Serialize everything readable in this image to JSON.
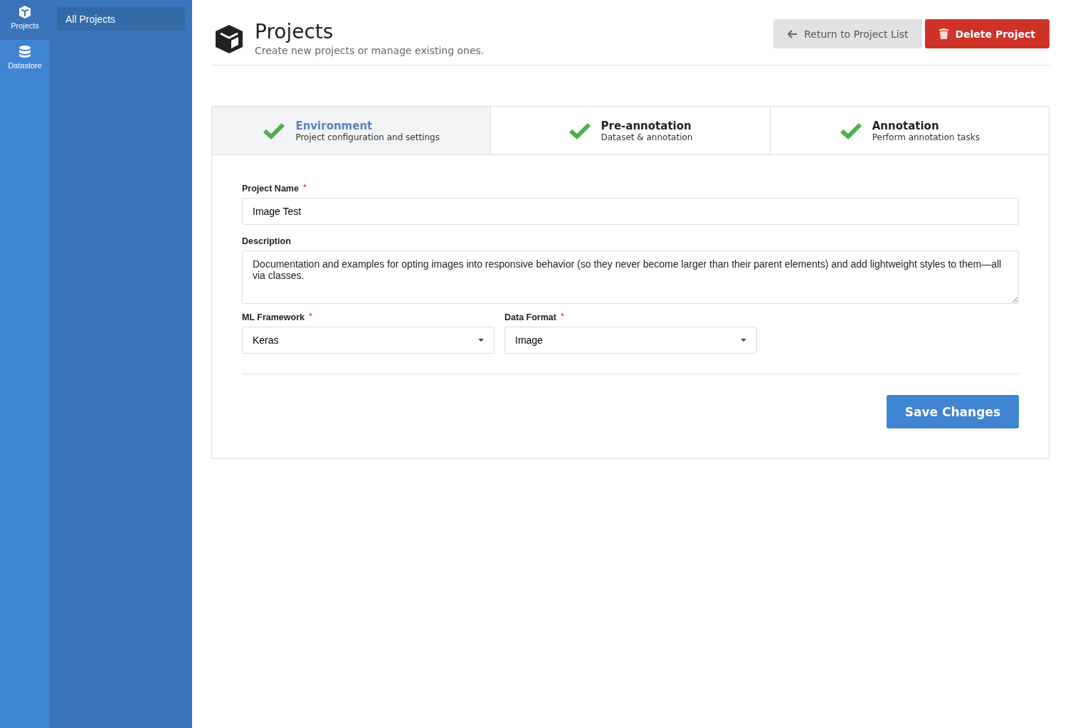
{
  "nav_rail": [
    {
      "label": "Projects",
      "kind": "cube",
      "selected": true
    },
    {
      "label": "Datastore",
      "kind": "database",
      "selected": false
    }
  ],
  "sidebar": {
    "items": [
      {
        "label": "All Projects",
        "selected": true
      }
    ]
  },
  "header": {
    "title": "Projects",
    "subtitle": "Create new projects or manage existing ones.",
    "buttons": [
      {
        "label": "Return to Project List",
        "kind": "back"
      },
      {
        "label": "Delete Project",
        "kind": "delete"
      }
    ]
  },
  "steps": [
    {
      "title": "Environment",
      "subtitle": "Project configuration and settings",
      "selected": true,
      "completed": true
    },
    {
      "title": "Pre-annotation",
      "subtitle": "Dataset & annotation",
      "selected": false,
      "completed": true
    },
    {
      "title": "Annotation",
      "subtitle": "Perform annotation tasks",
      "selected": false,
      "completed": true
    }
  ],
  "form": {
    "project_name": {
      "label": "Project Name",
      "required_mark": "*",
      "value": "Image Test"
    },
    "description": {
      "label": "Description",
      "value": "Documentation and examples for opting images into responsive behavior (so they never become larger than their parent elements) and add lightweight styles to them—all via classes."
    },
    "selects": [
      {
        "label": "ML Framework",
        "required_mark": "*",
        "value": "Keras"
      },
      {
        "label": "Data Format",
        "required_mark": "*",
        "value": "Image"
      }
    ],
    "save_button": "Save Changes"
  }
}
